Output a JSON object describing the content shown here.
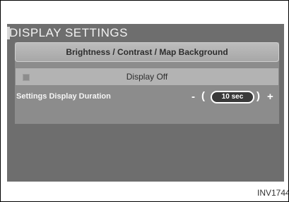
{
  "screen": {
    "title": "DISPLAY SETTINGS"
  },
  "menu": {
    "brightness_label": "Brightness / Contrast / Map Background",
    "display_off_label": "Display Off",
    "duration_label": "Settings Display Duration",
    "duration_minus": "-",
    "duration_plus": "+",
    "duration_arrow_left": "(",
    "duration_arrow_right": ")",
    "duration_value": "10 sec"
  },
  "figure": {
    "caption": "INV1744"
  },
  "colors": {
    "screen_background": "#6e6e6e",
    "panel_background": "#8c8c8c",
    "value_box": "#3a3a3a"
  }
}
